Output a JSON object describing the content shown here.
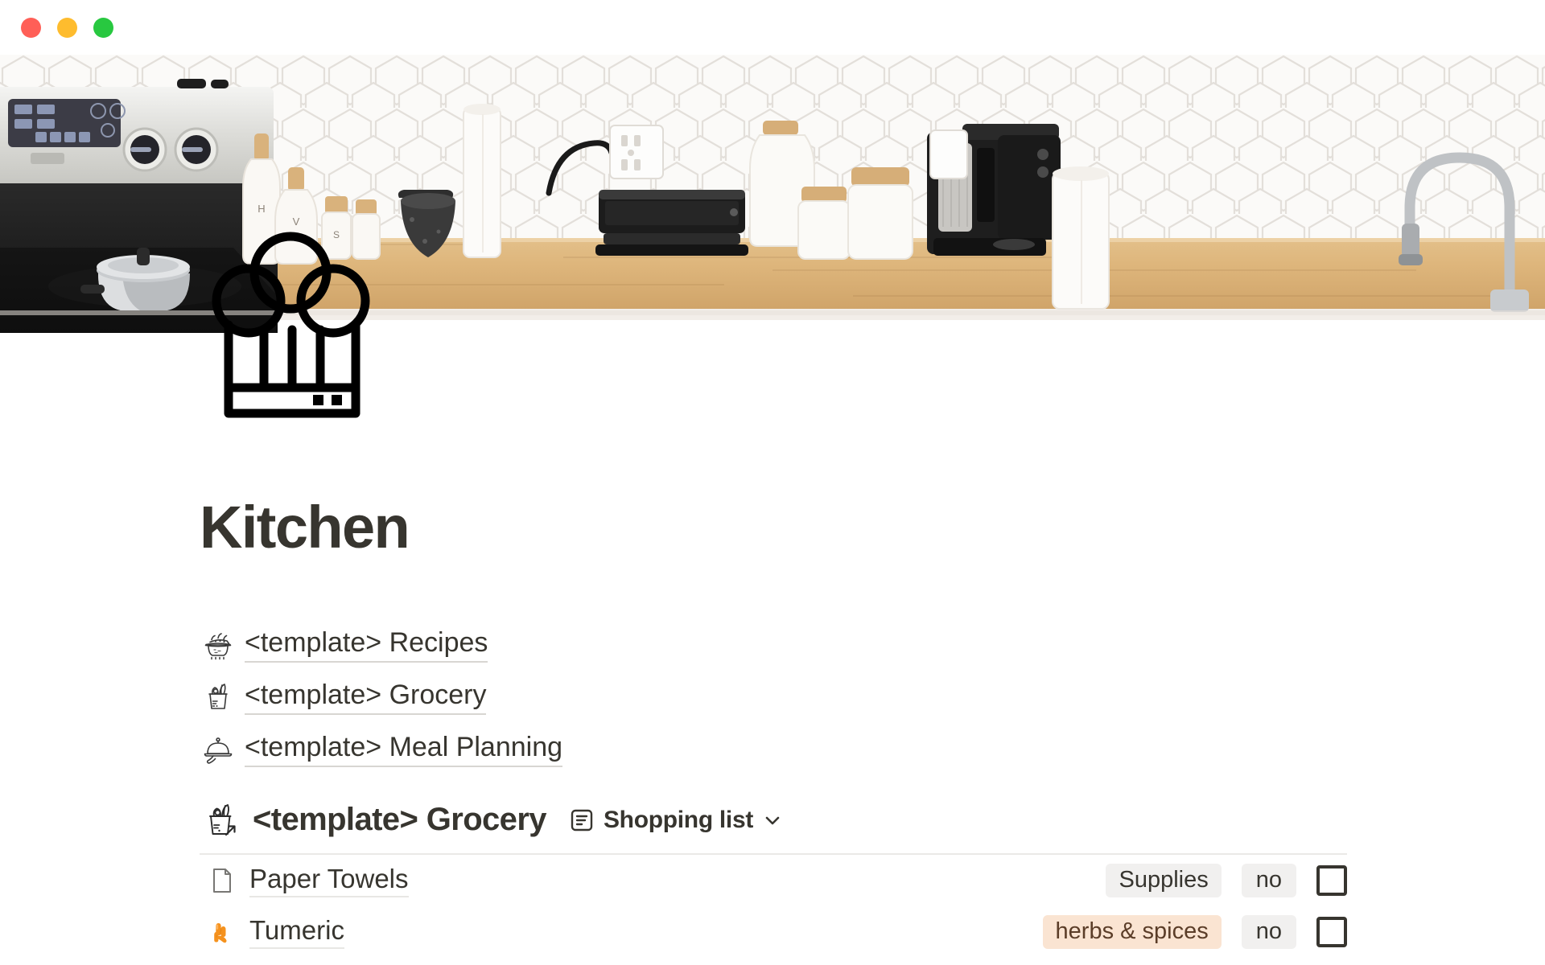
{
  "window": {
    "traffic_lights": [
      {
        "name": "close",
        "color": "#FF5F57"
      },
      {
        "name": "minimize",
        "color": "#FEBC2E"
      },
      {
        "name": "maximize",
        "color": "#28C840"
      }
    ]
  },
  "cover": {
    "alt": "Kitchen counter with stove, hexagon tile backsplash, ceramic canisters, espresso machine and paper towels"
  },
  "page": {
    "icon": "chef-hat-icon",
    "title": "Kitchen"
  },
  "links": [
    {
      "icon": "cooking-pot-icon",
      "label": "<template> Recipes"
    },
    {
      "icon": "grocery-bag-icon",
      "label": "<template> Grocery"
    },
    {
      "icon": "cloche-icon",
      "label": "<template> Meal Planning"
    }
  ],
  "database": {
    "icon": "grocery-bag-link-icon",
    "title": "<template> Grocery",
    "view": {
      "icon": "list-view-icon",
      "label": "Shopping list",
      "chevron": "chevron-down-icon"
    },
    "rows": [
      {
        "icon": "page-icon",
        "title": "Paper Towels",
        "category": "Supplies",
        "category_style": "gray",
        "purchased": "no",
        "checked": false
      },
      {
        "icon": "ginger-root-emoji",
        "title": "Tumeric",
        "category": "herbs & spices",
        "category_style": "peach",
        "purchased": "no",
        "checked": false
      }
    ]
  },
  "colors": {
    "text": "#37352F",
    "tag_gray_bg": "#F1F0EF",
    "tag_peach_bg": "#FAE4D2",
    "tag_peach_text": "#5B3D28",
    "divider": "#EAE9E7",
    "underline": "#D8D6D2"
  }
}
